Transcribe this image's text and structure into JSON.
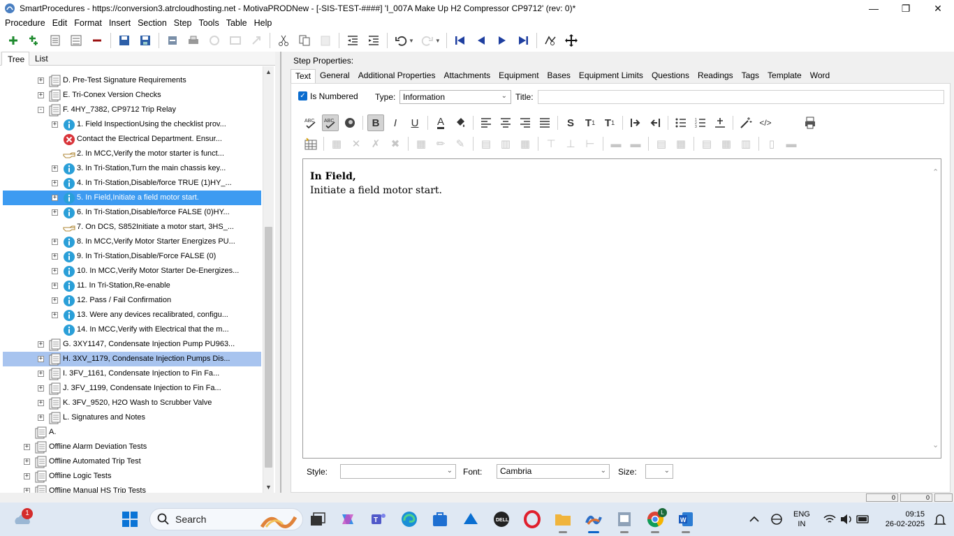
{
  "window": {
    "title": "SmartProcedures - https://conversion3.atrcloudhosting.net - MotivaPRODNew - [-SIS-TEST-####] 'I_007A Make Up H2 Compressor CP9712' (rev: 0)*"
  },
  "menu": [
    "Procedure",
    "Edit",
    "Format",
    "Insert",
    "Section",
    "Step",
    "Tools",
    "Table",
    "Help"
  ],
  "left_tabs": [
    "Tree",
    "List"
  ],
  "tree": [
    {
      "label": "D. Pre-Test Signature Requirements",
      "level": 1,
      "icon": "section-doc-icon",
      "expander": "+"
    },
    {
      "label": "E. Tri-Conex Version Checks",
      "level": 1,
      "icon": "section-doc-icon",
      "expander": "+"
    },
    {
      "label": "F. 4HY_7382, CP9712 Trip Relay",
      "level": 1,
      "icon": "section-doc-icon",
      "expander": "-"
    },
    {
      "label": "1. Field InspectionUsing the checklist prov...",
      "level": 2,
      "icon": "info-icon",
      "expander": "+"
    },
    {
      "label": "Contact the Electrical Department. Ensur...",
      "level": 2,
      "icon": "warning-x-icon",
      "expander": ""
    },
    {
      "label": "2. In MCC,Verify the motor starter is funct...",
      "level": 2,
      "icon": "pointing-hand-icon",
      "expander": ""
    },
    {
      "label": "3. In Tri-Station,Turn the main chassis key...",
      "level": 2,
      "icon": "info-icon",
      "expander": "+"
    },
    {
      "label": "4. In Tri-Station,Disable/force TRUE (1)HY_...",
      "level": 2,
      "icon": "info-icon",
      "expander": "+"
    },
    {
      "label": "5. In Field,Initiate a field motor start.",
      "level": 2,
      "icon": "info-icon",
      "expander": "+",
      "state": "selected"
    },
    {
      "label": "6. In Tri-Station,Disable/force FALSE (0)HY...",
      "level": 2,
      "icon": "info-icon",
      "expander": "+"
    },
    {
      "label": "7. On DCS, S852Initiate a motor start, 3HS_...",
      "level": 2,
      "icon": "pointing-hand-icon",
      "expander": ""
    },
    {
      "label": "8. In MCC,Verify Motor Starter Energizes PU...",
      "level": 2,
      "icon": "info-icon",
      "expander": "+"
    },
    {
      "label": "9. In Tri-Station,Disable/Force FALSE (0)",
      "level": 2,
      "icon": "info-icon",
      "expander": "+"
    },
    {
      "label": "10. In MCC,Verify Motor Starter De-Energizes...",
      "level": 2,
      "icon": "info-icon",
      "expander": "+"
    },
    {
      "label": "11. In Tri-Station,Re-enable",
      "level": 2,
      "icon": "info-icon",
      "expander": "+"
    },
    {
      "label": "12. Pass / Fail Confirmation",
      "level": 2,
      "icon": "info-icon",
      "expander": "+"
    },
    {
      "label": "13. Were any devices recalibrated, configu...",
      "level": 2,
      "icon": "info-icon",
      "expander": "+"
    },
    {
      "label": "14. In MCC,Verify with Electrical that the m...",
      "level": 2,
      "icon": "info-icon",
      "expander": ""
    },
    {
      "label": "G. 3XY1147, Condensate Injection Pump PU963...",
      "level": 1,
      "icon": "section-doc-icon",
      "expander": "+"
    },
    {
      "label": "H. 3XV_1179, Condensate Injection Pumps Dis...",
      "level": 1,
      "icon": "section-doc-icon",
      "expander": "+",
      "state": "highlighted"
    },
    {
      "label": "I. 3FV_1161, Condensate Injection to Fin Fa...",
      "level": 1,
      "icon": "section-doc-icon",
      "expander": "+"
    },
    {
      "label": "J. 3FV_1199, Condensate Injection to Fin Fa...",
      "level": 1,
      "icon": "section-doc-icon",
      "expander": "+"
    },
    {
      "label": "K. 3FV_9520, H2O Wash to Scrubber Valve",
      "level": 1,
      "icon": "section-doc-icon",
      "expander": "+"
    },
    {
      "label": "L. Signatures and Notes",
      "level": 1,
      "icon": "section-doc-icon",
      "expander": "+"
    },
    {
      "label": "A.",
      "level": 0,
      "icon": "procedure-doc-icon",
      "expander": ""
    },
    {
      "label": "Offline Alarm Deviation Tests",
      "level": 0,
      "icon": "procedure-doc-icon",
      "expander": "+"
    },
    {
      "label": "Offline Automated Trip Test",
      "level": 0,
      "icon": "procedure-doc-icon",
      "expander": "+"
    },
    {
      "label": "Offline Logic Tests",
      "level": 0,
      "icon": "procedure-doc-icon",
      "expander": "+"
    },
    {
      "label": "Offline Manual HS Trip Tests",
      "level": 0,
      "icon": "procedure-doc-icon",
      "expander": "+"
    }
  ],
  "step_properties": {
    "heading": "Step Properties:",
    "tabs": [
      "Text",
      "General",
      "Additional Properties",
      "Attachments",
      "Equipment",
      "Bases",
      "Equipment Limits",
      "Questions",
      "Readings",
      "Tags",
      "Template",
      "Word"
    ],
    "is_numbered_label": "Is Numbered",
    "is_numbered_checked": true,
    "type_label": "Type:",
    "type_value": "Information",
    "title_label": "Title:",
    "title_value": ""
  },
  "editor": {
    "line1": "In Field,",
    "line2": "Initiate a field motor start."
  },
  "style_bar": {
    "style_label": "Style:",
    "style_value": "",
    "font_label": "Font:",
    "font_value": "Cambria",
    "size_label": "Size:",
    "size_value": ""
  },
  "status": {
    "box1": "0",
    "box2": "0"
  },
  "taskbar": {
    "search_placeholder": "Search",
    "notification_count": "1",
    "lang_line1": "ENG",
    "lang_line2": "IN",
    "time": "09:15",
    "date": "26-02-2025",
    "chrome_badge": "L"
  },
  "colors": {
    "selection": "#3d9bf1",
    "highlight": "#a8c4ef",
    "info_icon": "#2a9fd8",
    "warning_icon": "#d9343a",
    "checkbox": "#0a6ccf"
  }
}
